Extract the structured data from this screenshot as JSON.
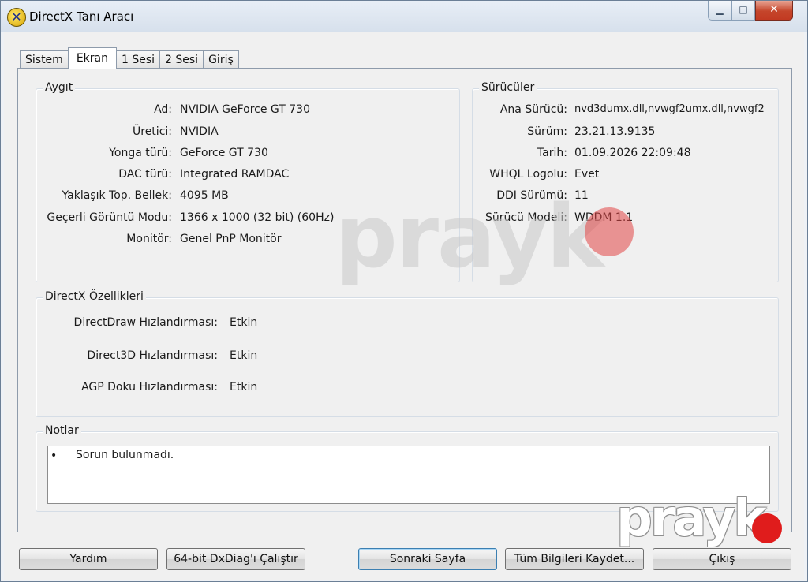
{
  "window": {
    "title": "DirectX Tanı Aracı",
    "icon": "directx-icon",
    "controls": {
      "minimize": "▁",
      "maximize": "□",
      "close": "✕"
    }
  },
  "tabs": [
    {
      "label": "Sistem",
      "active": false
    },
    {
      "label": "Ekran",
      "active": true
    },
    {
      "label": "1 Sesi",
      "active": false
    },
    {
      "label": "2 Sesi",
      "active": false
    },
    {
      "label": "Giriş",
      "active": false
    }
  ],
  "device": {
    "title": "Aygıt",
    "rows": [
      {
        "label": "Ad:",
        "value": "NVIDIA GeForce GT 730"
      },
      {
        "label": "Üretici:",
        "value": "NVIDIA"
      },
      {
        "label": "Yonga türü:",
        "value": "GeForce GT 730"
      },
      {
        "label": "DAC türü:",
        "value": "Integrated RAMDAC"
      },
      {
        "label": "Yaklaşık Top. Bellek:",
        "value": "4095 MB"
      },
      {
        "label": "Geçerli Görüntü Modu:",
        "value": "1366 x 1000 (32 bit) (60Hz)"
      },
      {
        "label": "Monitör:",
        "value": "Genel PnP Monitör"
      }
    ]
  },
  "drivers": {
    "title": "Sürücüler",
    "rows": [
      {
        "label": "Ana Sürücü:",
        "value": "nvd3dumx.dll,nvwgf2umx.dll,nvwgf2"
      },
      {
        "label": "Sürüm:",
        "value": "23.21.13.9135"
      },
      {
        "label": "Tarih:",
        "value": "01.09.2026 22:09:48"
      },
      {
        "label": "WHQL Logolu:",
        "value": "Evet"
      },
      {
        "label": "DDI Sürümü:",
        "value": "11"
      },
      {
        "label": "Sürücü Modeli:",
        "value": "WDDM 1.1"
      }
    ]
  },
  "features": {
    "title": "DirectX Özellikleri",
    "rows": [
      {
        "label": "DirectDraw Hızlandırması:",
        "value": "Etkin"
      },
      {
        "label": "Direct3D Hızlandırması:",
        "value": "Etkin"
      },
      {
        "label": "AGP Doku Hızlandırması:",
        "value": "Etkin"
      }
    ]
  },
  "notes": {
    "title": "Notlar",
    "bullet": "•",
    "text": "Sorun bulunmadı."
  },
  "buttons": {
    "help": "Yardım",
    "run64": "64-bit DxDiag'ı Çalıştır",
    "next": "Sonraki Sayfa",
    "save": "Tüm Bilgileri Kaydet...",
    "exit": "Çıkış"
  },
  "watermark": {
    "text": "prayk",
    "dot_color": "#e01c1c"
  }
}
